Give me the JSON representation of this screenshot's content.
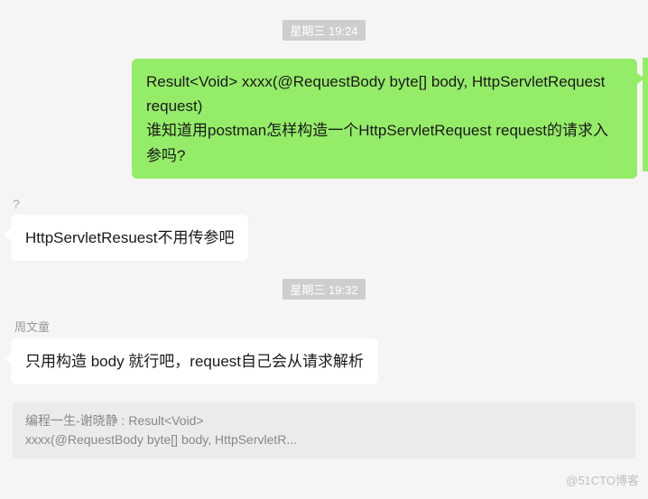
{
  "timestamps": {
    "first": "星期三 19:24",
    "second": "星期三 19:32"
  },
  "messages": {
    "sent1": {
      "line1": "Result<Void> xxxx(@RequestBody byte[] body, HttpServletRequest request)",
      "line2": "谁知道用postman怎样构造一个HttpServletRequest request的请求入参吗?"
    },
    "recv1": {
      "pre_mark": "?",
      "text": "HttpServletResuest不用传参吧"
    },
    "recv2": {
      "sender": "周文童",
      "text": "只用构造 body 就行吧，request自己会从请求解析"
    },
    "quote": {
      "line1": "编程一生-谢晓静 : Result<Void>",
      "line2": "xxxx(@RequestBody byte[] body, HttpServletR..."
    }
  },
  "watermark": "@51CTO博客"
}
